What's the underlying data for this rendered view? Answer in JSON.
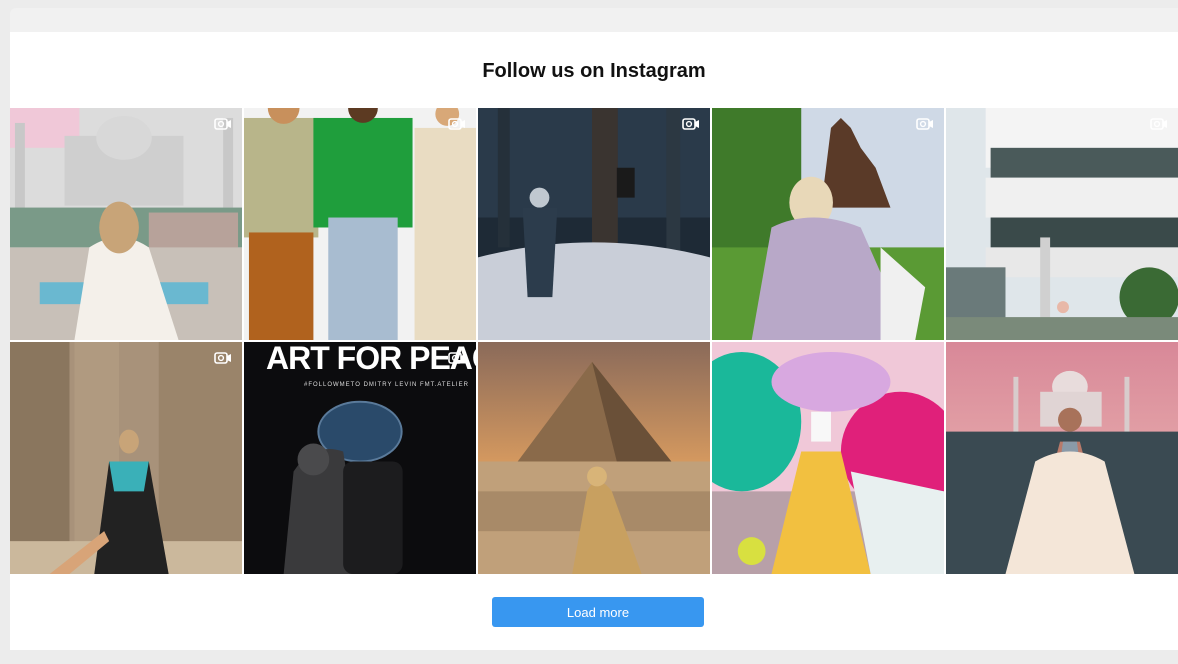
{
  "section": {
    "title": "Follow us on Instagram"
  },
  "posts": [
    {
      "media_icon": "video-camera-icon",
      "colors": {
        "sky": "#d8d8d8",
        "ground": "#9aa8a8",
        "accent": "#f0c8d8"
      }
    },
    {
      "media_icon": "video-camera-icon",
      "colors": {
        "sky": "#f2f2f2",
        "ground": "#e8e8e8",
        "accent": "#1f9e3c"
      }
    },
    {
      "media_icon": "video-camera-icon",
      "colors": {
        "sky": "#1e2a36",
        "ground": "#c9ced8",
        "accent": "#2a3c4c"
      }
    },
    {
      "media_icon": "video-camera-icon",
      "colors": {
        "sky": "#cfd9e6",
        "ground": "#4c8c2c",
        "accent": "#6a4a3a"
      }
    },
    {
      "media_icon": "video-camera-icon",
      "colors": {
        "sky": "#dfe6ea",
        "ground": "#6a7a7a",
        "accent": "#ffffff"
      }
    },
    {
      "media_icon": "video-camera-icon",
      "colors": {
        "sky": "#a8927a",
        "ground": "#7a6452",
        "accent": "#3ab0b8"
      }
    },
    {
      "media_icon": "video-camera-icon",
      "headline": "ART FOR PEACE",
      "subline": "#FOLLOWMETO   DMITRY LEVIN   FMT.ATELIER",
      "colors": {
        "sky": "#0c0c0e",
        "ground": "#1c1c1e",
        "accent": "#2a4a6a"
      }
    },
    {
      "media_icon": "",
      "colors": {
        "sky": "#d08a5a",
        "ground": "#c09a72",
        "accent": "#8a6a4a"
      }
    },
    {
      "media_icon": "",
      "colors": {
        "sky": "#f0c8d8",
        "ground": "#1ab89a",
        "accent": "#e0207a"
      }
    },
    {
      "media_icon": "",
      "colors": {
        "sky": "#e6a2a8",
        "ground": "#3a4a52",
        "accent": "#f4e6d8"
      }
    }
  ],
  "actions": {
    "load_more_label": "Load more"
  },
  "theme": {
    "button_color": "#3897f0"
  }
}
